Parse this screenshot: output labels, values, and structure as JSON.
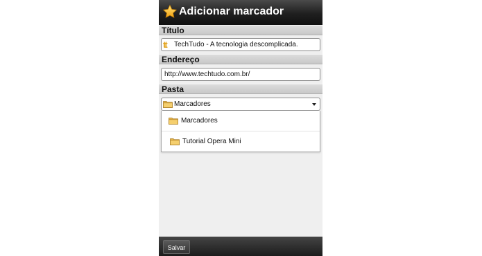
{
  "header": {
    "title": "Adicionar marcador",
    "icon": "star-icon"
  },
  "form": {
    "titulo_label": "Título",
    "titulo_value": "TechTudo - A tecnologia descomplicada.",
    "endereco_label": "Endereço",
    "endereco_value": "http://www.techtudo.com.br/",
    "pasta_label": "Pasta",
    "pasta_selected": "Marcadores"
  },
  "dropdown": {
    "options": [
      {
        "label": "Marcadores",
        "icon": "folder-icon"
      },
      {
        "label": "Tutorial Opera Mini",
        "icon": "folder-icon"
      }
    ]
  },
  "footer": {
    "save_label": "Salvar"
  },
  "colors": {
    "titlebar": "#1f1f1f",
    "favicon": "#e2a21a",
    "folder": "#e8b64a"
  }
}
